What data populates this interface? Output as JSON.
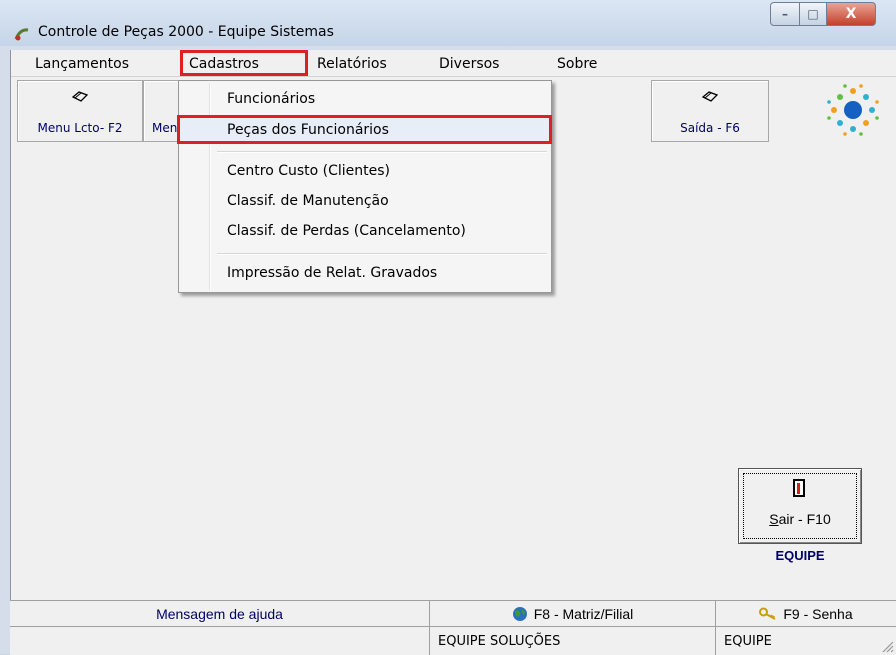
{
  "window": {
    "title": "Controle de Peças 2000 - Equipe Sistemas",
    "minimize_label": "–",
    "maximize_label": "□",
    "close_label": "X"
  },
  "menubar": {
    "items": [
      {
        "label": "Lançamentos"
      },
      {
        "label": "Cadastros"
      },
      {
        "label": "Relatórios"
      },
      {
        "label": "Diversos"
      },
      {
        "label": "Sobre"
      }
    ]
  },
  "toolbar": {
    "menu_lcto_label": "Menu Lcto- F2",
    "menu_partial_label": "Men",
    "saida_label": "Saída - F6"
  },
  "dropdown": {
    "items": [
      {
        "label": "Funcionários"
      },
      {
        "label": "Peças dos Funcionários"
      },
      {
        "label": "Centro Custo (Clientes)"
      },
      {
        "label": "Classif. de Manutenção"
      },
      {
        "label": "Classif. de Perdas (Cancelamento)"
      },
      {
        "label": "Impressão de Relat. Gravados"
      }
    ]
  },
  "sair_button": {
    "label_accel": "S",
    "label_rest": "air - F10"
  },
  "equipe_label": "EQUIPE",
  "statusbar": {
    "help_message": "Mensagem de ajuda",
    "matriz_filial": "F8 - Matriz/Filial",
    "senha": "F9 - Senha",
    "company": "EQUIPE SOLUÇÕES",
    "user": "EQUIPE"
  },
  "colors": {
    "highlight_border": "#e02020",
    "label_blue": "#00006b"
  },
  "icons": {
    "title": "app-icon",
    "toolbar": "book-icon",
    "logo": "dots-logo",
    "sair": "door-exit-icon",
    "matriz": "globe-icon",
    "senha": "key-icon"
  }
}
